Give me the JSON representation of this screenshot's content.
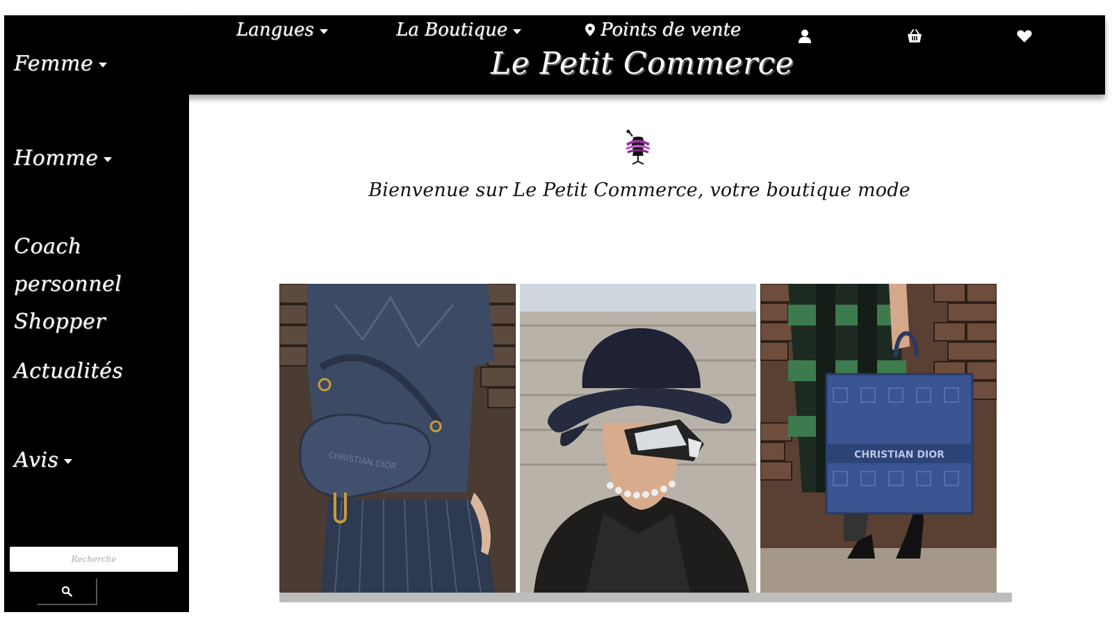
{
  "sidebar": {
    "items": [
      {
        "label": "Femme",
        "has_dropdown": true
      },
      {
        "label": "Homme",
        "has_dropdown": true
      },
      {
        "label": "Coach personnel",
        "label2": "Shopper",
        "has_dropdown": false
      },
      {
        "label": "Actualités",
        "has_dropdown": false
      },
      {
        "label": "Avis",
        "has_dropdown": true
      }
    ],
    "search": {
      "placeholder": "Recherche",
      "button_icon": "search-icon"
    }
  },
  "topbar": {
    "languages_label": "Langues",
    "shop_label": "La Boutique",
    "stores_label": "Points de vente",
    "stores_icon": "map-marker-icon",
    "brand": "Le Petit Commerce",
    "icons": [
      "user-icon",
      "basket-icon",
      "heart-icon"
    ]
  },
  "main": {
    "logo_icon": "dress-form-icon",
    "welcome": "Bienvenue sur Le Petit Commerce, votre boutique mode",
    "gallery": [
      {
        "subject": "denim saddle bag with pleated skirt",
        "bag_text": "CHRISTIAN DIOR"
      },
      {
        "subject": "model in bucket hat and mirrored sunglasses"
      },
      {
        "subject": "blue oblique book tote",
        "bag_text": "CHRISTIAN DIOR"
      }
    ]
  },
  "colors": {
    "bar": "#000000",
    "text_light": "#ffffff",
    "accent_purple": "#9b2fa3"
  }
}
